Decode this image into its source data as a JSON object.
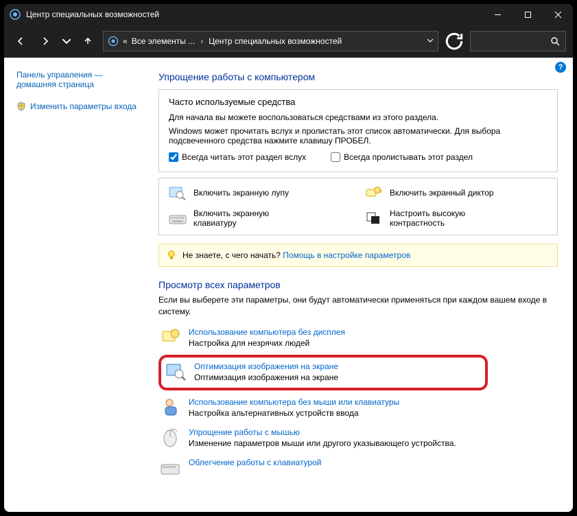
{
  "window": {
    "title": "Центр специальных возможностей"
  },
  "breadcrumb": {
    "prefix": "«",
    "part1": "Все элементы ...",
    "part2": "Центр специальных возможностей"
  },
  "sidebar": {
    "home_line1": "Панель управления —",
    "home_line2": "домашняя страница",
    "uac_link": "Изменить параметры входа"
  },
  "main": {
    "h1": "Упрощение работы с компьютером",
    "group": {
      "title": "Часто используемые средства",
      "desc1": "Для начала вы можете воспользоваться средствами из этого раздела.",
      "desc2": "Windows может прочитать вслух и пролистать этот список автоматически. Для выбора подсвеченного средства нажмите клавишу ПРОБЕЛ.",
      "cb1": "Всегда читать этот раздел вслух",
      "cb2": "Всегда пролистывать этот раздел"
    },
    "tools": {
      "magnifier": "Включить экранную лупу",
      "narrator": "Включить экранный диктор",
      "osk_line1": "Включить экранную",
      "osk_line2": "клавиатуру",
      "contrast_line1": "Настроить высокую",
      "contrast_line2": "контрастность"
    },
    "hint": {
      "text": "Не знаете, с чего начать? ",
      "link": "Помощь в настройке параметров"
    },
    "h2": "Просмотр всех параметров",
    "h2_desc": "Если вы выберете эти параметры, они будут автоматически применяться при каждом вашем входе в систему.",
    "opts": {
      "o1_link": "Использование компьютера без дисплея",
      "o1_desc": "Настройка для незрячих людей",
      "o2_link": "Оптимизация изображения на экране",
      "o2_desc": "Оптимизация изображения на экране",
      "o3_link": "Использование компьютера без мыши или клавиатуры",
      "o3_desc": "Настройка альтернативных устройств ввода",
      "o4_link": "Упрощение работы с мышью",
      "o4_desc": "Изменение параметров мыши или другого указывающего устройства.",
      "o5_link": "Облегчение работы с клавиатурой"
    }
  }
}
